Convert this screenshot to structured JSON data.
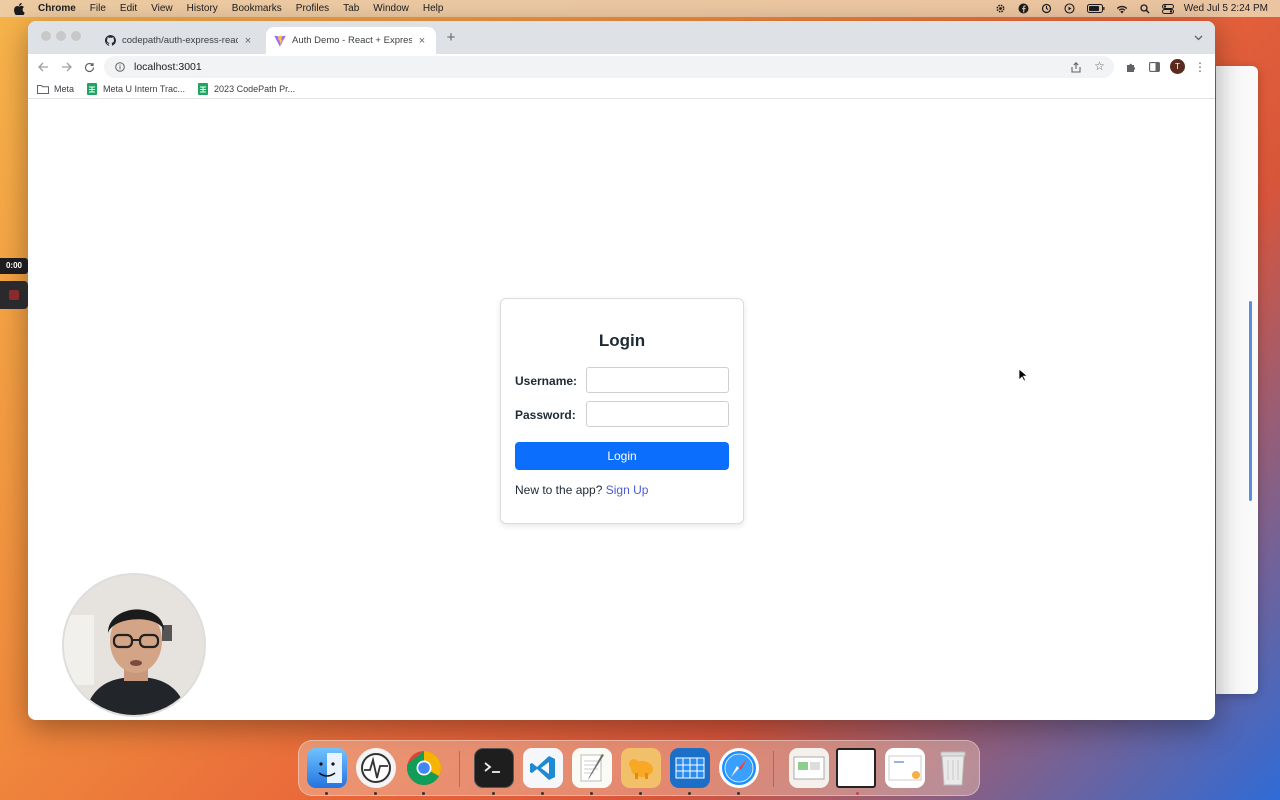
{
  "menubar": {
    "app_name": "Chrome",
    "items": [
      "File",
      "Edit",
      "View",
      "History",
      "Bookmarks",
      "Profiles",
      "Tab",
      "Window",
      "Help"
    ],
    "clock": "Wed Jul 5  2:24 PM"
  },
  "browser": {
    "tabs": [
      {
        "title": "codepath/auth-express-react-",
        "favicon": "github-icon",
        "active": false
      },
      {
        "title": "Auth Demo - React + Express",
        "favicon": "vite-icon",
        "active": true
      }
    ],
    "url": "localhost:3001",
    "profile_initial": "T",
    "bookmarks": [
      {
        "label": "Meta",
        "icon": "folder-icon"
      },
      {
        "label": "Meta U Intern Trac...",
        "icon": "sheets-icon"
      },
      {
        "label": "2023 CodePath Pr...",
        "icon": "sheets-icon"
      }
    ]
  },
  "login": {
    "title": "Login",
    "username_label": "Username:",
    "username_value": "",
    "password_label": "Password:",
    "password_value": "",
    "submit_label": "Login",
    "signup_prompt": "New to the app?",
    "signup_link": "Sign Up",
    "accent_color": "#0b6efd"
  },
  "recording": {
    "timer": "0:00"
  },
  "colors": {
    "link": "#4a5bd6",
    "heading": "#1e2a35"
  }
}
